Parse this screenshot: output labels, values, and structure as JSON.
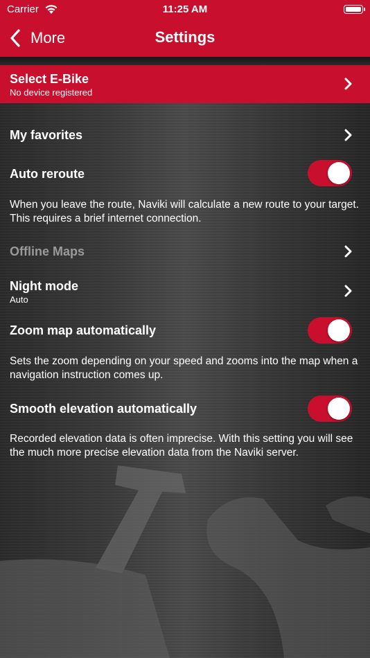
{
  "status": {
    "carrier": "Carrier",
    "time": "11:25 AM"
  },
  "nav": {
    "back_label": "More",
    "title": "Settings"
  },
  "ebike": {
    "label": "Select E-Bike",
    "sublabel": "No device registered"
  },
  "rows": {
    "favorites": {
      "label": "My favorites"
    },
    "auto_reroute": {
      "label": "Auto reroute",
      "on": true,
      "description": "When you leave the route, Naviki will calculate a new route to your target. This requires a brief internet connection."
    },
    "offline_maps": {
      "label": "Offline Maps"
    },
    "night_mode": {
      "label": "Night mode",
      "value": "Auto"
    },
    "zoom": {
      "label": "Zoom map automatically",
      "on": true,
      "description": "Sets the zoom depending on your speed and zooms into the map when a navigation instruction comes up."
    },
    "smooth": {
      "label": "Smooth elevation automatically",
      "on": true,
      "description": "Recorded elevation data is often imprecise. With this setting you will see the much more precise elevation data from the Naviki server."
    }
  },
  "colors": {
    "accent": "#c8102e"
  }
}
